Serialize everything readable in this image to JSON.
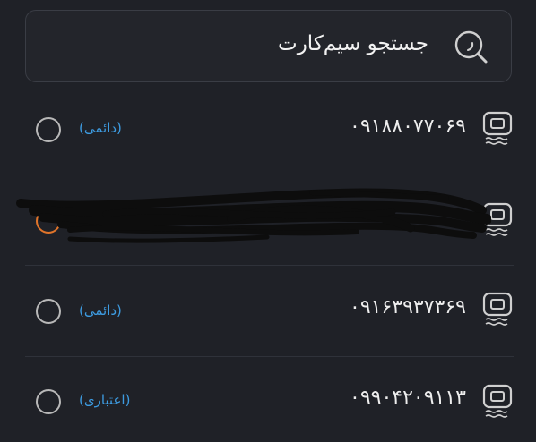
{
  "search": {
    "text": "جستجو سیم‌کارت",
    "icon": "search-icon"
  },
  "sim_list": [
    {
      "number": "۰۹۱۸۸۰۷۷۰۶۹",
      "type": "(دائمی)",
      "icon": "sim-card-icon",
      "selected": false,
      "redacted": false
    },
    {
      "number": "",
      "type": "",
      "icon": "sim-card-icon",
      "selected": false,
      "redacted": true
    },
    {
      "number": "۰۹۱۶۳۹۳۷۳۶۹",
      "type": "(دائمی)",
      "icon": "sim-card-icon",
      "selected": false,
      "redacted": false
    },
    {
      "number": "۰۹۹۰۴۲۰۹۱۱۳",
      "type": "(اعتباری)",
      "icon": "sim-card-icon",
      "selected": false,
      "redacted": false
    }
  ],
  "colors": {
    "background": "#1f2127",
    "accent": "#3d9be0",
    "redaction": "#0d0d0d"
  }
}
